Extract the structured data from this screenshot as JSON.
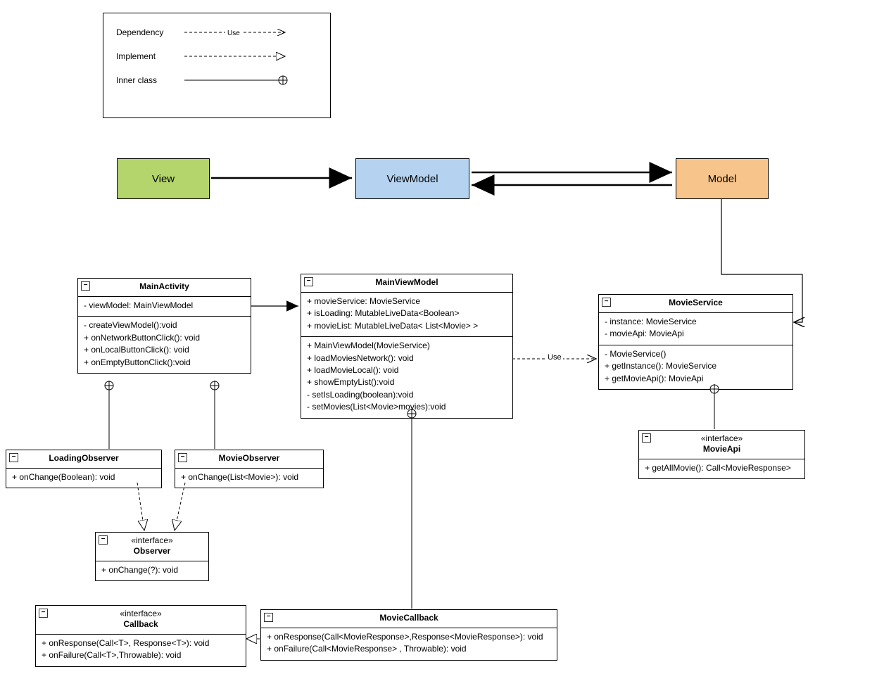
{
  "legend": {
    "dependency": "Dependency",
    "dependency_stereo": "Use",
    "implement": "Implement",
    "innerclass": "Inner class"
  },
  "mvvm": {
    "view": "View",
    "viewmodel": "ViewModel",
    "model": "Model"
  },
  "mainActivity": {
    "title": "MainActivity",
    "attrs": "- viewModel: MainViewModel",
    "ops": "- createViewModel():void\n+ onNetworkButtonClick(): void\n+ onLocalButtonClick(): void\n+ onEmptyButtonClick():void"
  },
  "mainViewModel": {
    "title": "MainViewModel",
    "attrs": "+ movieService: MovieService\n+ isLoading: MutableLiveData<Boolean>\n+ movieList: MutableLiveData< List<Movie> >",
    "ops": "+ MainViewModel(MovieService)\n+ loadMoviesNetwork(): void\n+ loadMovieLocal(): void\n+ showEmptyList():void\n- setIsLoading(boolean):void\n- setMovies(List<Movie>movies):void"
  },
  "movieService": {
    "title": "MovieService",
    "attrs": "- instance: MovieService\n- movieApi: MovieApi",
    "ops": "- MovieService()\n+ getInstance(): MovieService\n+ getMovieApi(): MovieApi"
  },
  "loadingObserver": {
    "title": "LoadingObserver",
    "ops": "+ onChange(Boolean): void"
  },
  "movieObserver": {
    "title": "MovieObserver",
    "ops": "+ onChange(List<Movie>): void"
  },
  "observer": {
    "stereo": "«interface»",
    "title": "Observer",
    "ops": "+ onChange(?): void"
  },
  "movieApi": {
    "stereo": "«interface»",
    "title": "MovieApi",
    "ops": "+ getAllMovie(): Call<MovieResponse>"
  },
  "callback": {
    "stereo": "«interface»",
    "title": "Callback",
    "ops": "+ onResponse(Call<T>, Response<T>): void\n+ onFailure(Call<T>,Throwable): void"
  },
  "movieCallback": {
    "title": "MovieCallback",
    "ops": "+ onResponse(Call<MovieResponse>,Response<MovieResponse>): void\n+ onFailure(Call<MovieResponse> , Throwable): void"
  },
  "useLabelVMtoService": "Use"
}
